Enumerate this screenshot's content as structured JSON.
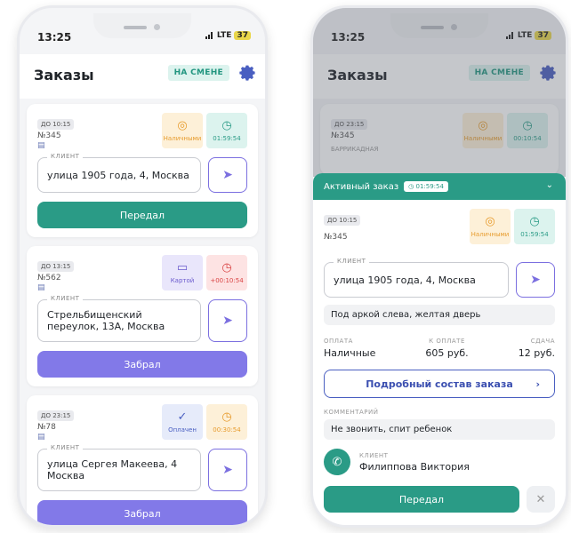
{
  "status": {
    "time": "13:25",
    "network": "LTE",
    "battery": "37"
  },
  "header": {
    "title": "Заказы",
    "shift_label": "НА СМЕНЕ"
  },
  "address_label": "КЛИЕНТ",
  "orders": [
    {
      "due": "ДО 10:15",
      "number": "№345",
      "payment": "Наличными",
      "timer": "01:59:54",
      "address": "улица 1905 года, 4, Москва",
      "action": "Передал"
    },
    {
      "due": "ДО 13:15",
      "number": "№562",
      "payment": "Картой",
      "timer": "+00:10:54",
      "address": "Стрельбищенский переулок, 13А, Москва",
      "action": "Забрал"
    },
    {
      "due": "ДО 23:15",
      "number": "№78",
      "payment": "Оплачен",
      "timer": "00:30:54",
      "address": "улица Сергея Макеева, 4 Москва",
      "action": "Забрал"
    }
  ],
  "right": {
    "bg_order": {
      "due": "ДО 23:15",
      "number": "№345",
      "payment": "Наличными",
      "timer": "00:10:54",
      "address_hint": "БАРРИКАДНАЯ"
    },
    "sheet": {
      "title": "Активный заказ",
      "timer": "01:59:54",
      "due": "ДО 10:15",
      "number": "№345",
      "payment": "Наличными",
      "order_timer": "01:59:54",
      "address": "улица 1905 года, 4, Москва",
      "note": "Под аркой слева, желтая дверь",
      "pay_method_label": "ОПЛАТА",
      "pay_method": "Наличные",
      "to_pay_label": "К ОПЛАТЕ",
      "to_pay": "605 руб.",
      "change_label": "СДАЧА",
      "change": "12 руб.",
      "details_button": "Подробный состав заказа",
      "comment_label": "КОММЕНТАРИЙ",
      "comment": "Не звонить, спит ребенок",
      "client_label": "КЛИЕНТ",
      "client_name": "Филиппова Виктория",
      "action": "Передал"
    }
  },
  "colors": {
    "accent": "#2a9b86",
    "purple": "#8279e8",
    "blue": "#4a5fc1"
  }
}
